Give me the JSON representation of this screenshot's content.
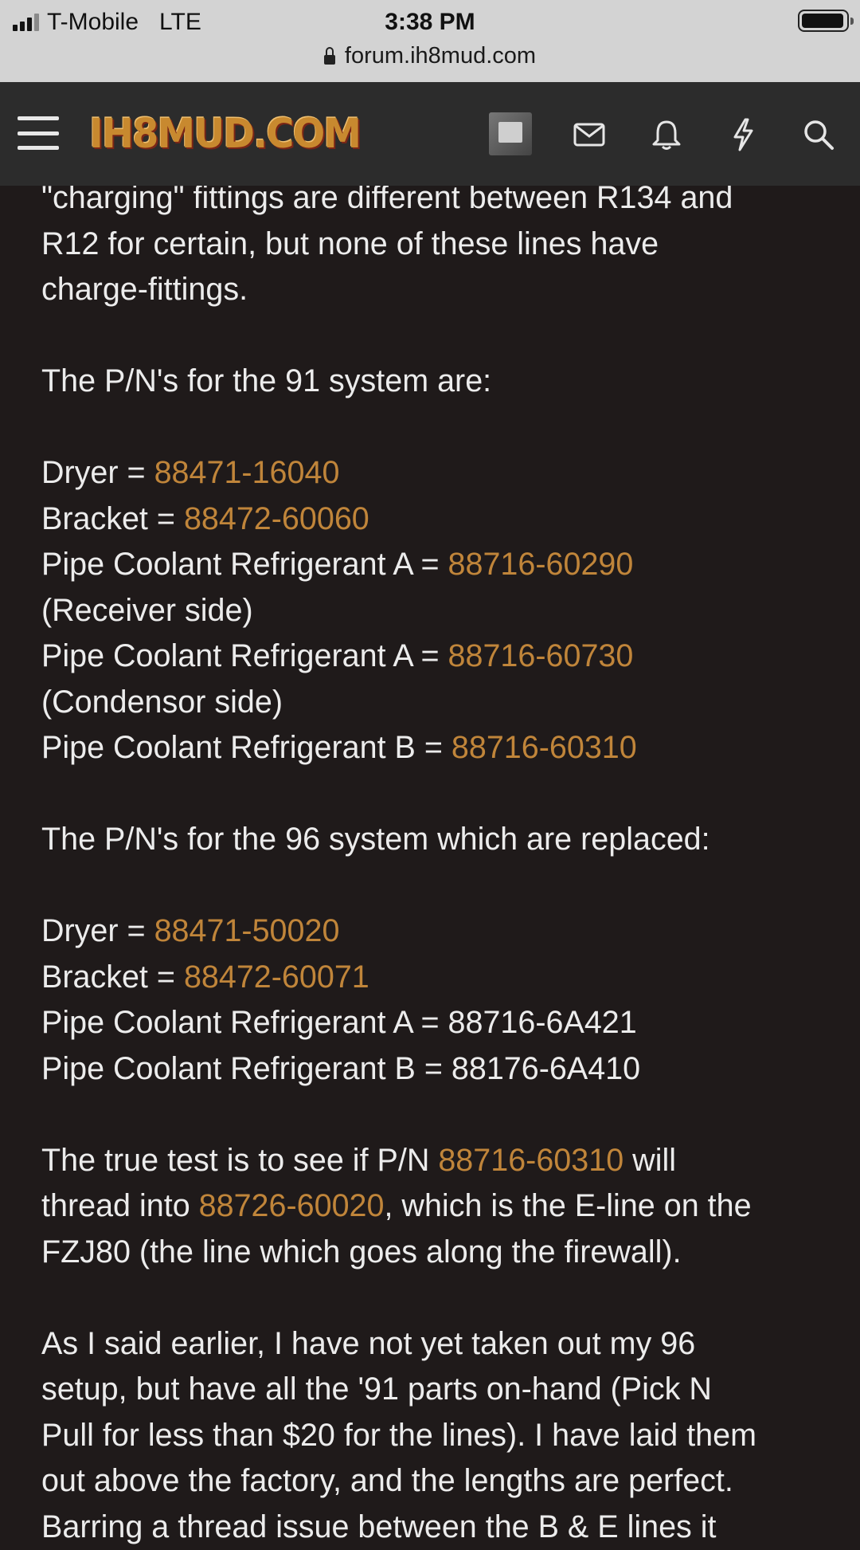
{
  "status_bar": {
    "carrier": "T-Mobile",
    "network": "LTE",
    "time": "3:38 PM",
    "url": "forum.ih8mud.com"
  },
  "header": {
    "logo_text": "IH8MUD.COM",
    "icons": [
      "menu-icon",
      "avatar",
      "mail-icon",
      "bell-icon",
      "bolt-icon",
      "search-icon"
    ]
  },
  "post": {
    "intro": {
      "l1": "\"charging\" fittings are different between R134 and",
      "l2": "R12 for certain, but none of these lines have",
      "l3": "charge-fittings."
    },
    "sys91": {
      "heading": "The P/N's for the 91 system are:",
      "dryer_label": "Dryer = ",
      "dryer_pn": "88471-16040",
      "bracket_label": "Bracket = ",
      "bracket_pn": "88472-60060",
      "pipe_a1_label": "Pipe Coolant Refrigerant A = ",
      "pipe_a1_pn": "88716-60290",
      "pipe_a1_note": "(Receiver side)",
      "pipe_a2_label": "Pipe Coolant Refrigerant A = ",
      "pipe_a2_pn": "88716-60730",
      "pipe_a2_note": "(Condensor side)",
      "pipe_b_label": "Pipe Coolant Refrigerant B = ",
      "pipe_b_pn": "88716-60310"
    },
    "sys96": {
      "heading": "The P/N's for the 96 system which are replaced:",
      "dryer_label": "Dryer = ",
      "dryer_pn": "88471-50020",
      "bracket_label": "Bracket = ",
      "bracket_pn": "88472-60071",
      "pipe_a": "Pipe Coolant Refrigerant A = 88716-6A421",
      "pipe_b": "Pipe Coolant Refrigerant B = 88176-6A410"
    },
    "test": {
      "t1": "The true test is to see if P/N ",
      "pn1": "88716-60310",
      "t2": " will",
      "t3": "thread into ",
      "pn2": "88726-60020",
      "t4": ", which is the E-line on the",
      "t5": "FZJ80 (the line which goes along the firewall)."
    },
    "closing": {
      "l1": "As I said earlier, I have not yet taken out my 96",
      "l2": "setup, but have all the '91 parts on-hand (Pick N",
      "l3": "Pull for less than $20 for the lines). I have laid them",
      "l4": "out above the factory, and the lengths are perfect.",
      "l5": "Barring a thread issue between the B & E lines it"
    }
  }
}
